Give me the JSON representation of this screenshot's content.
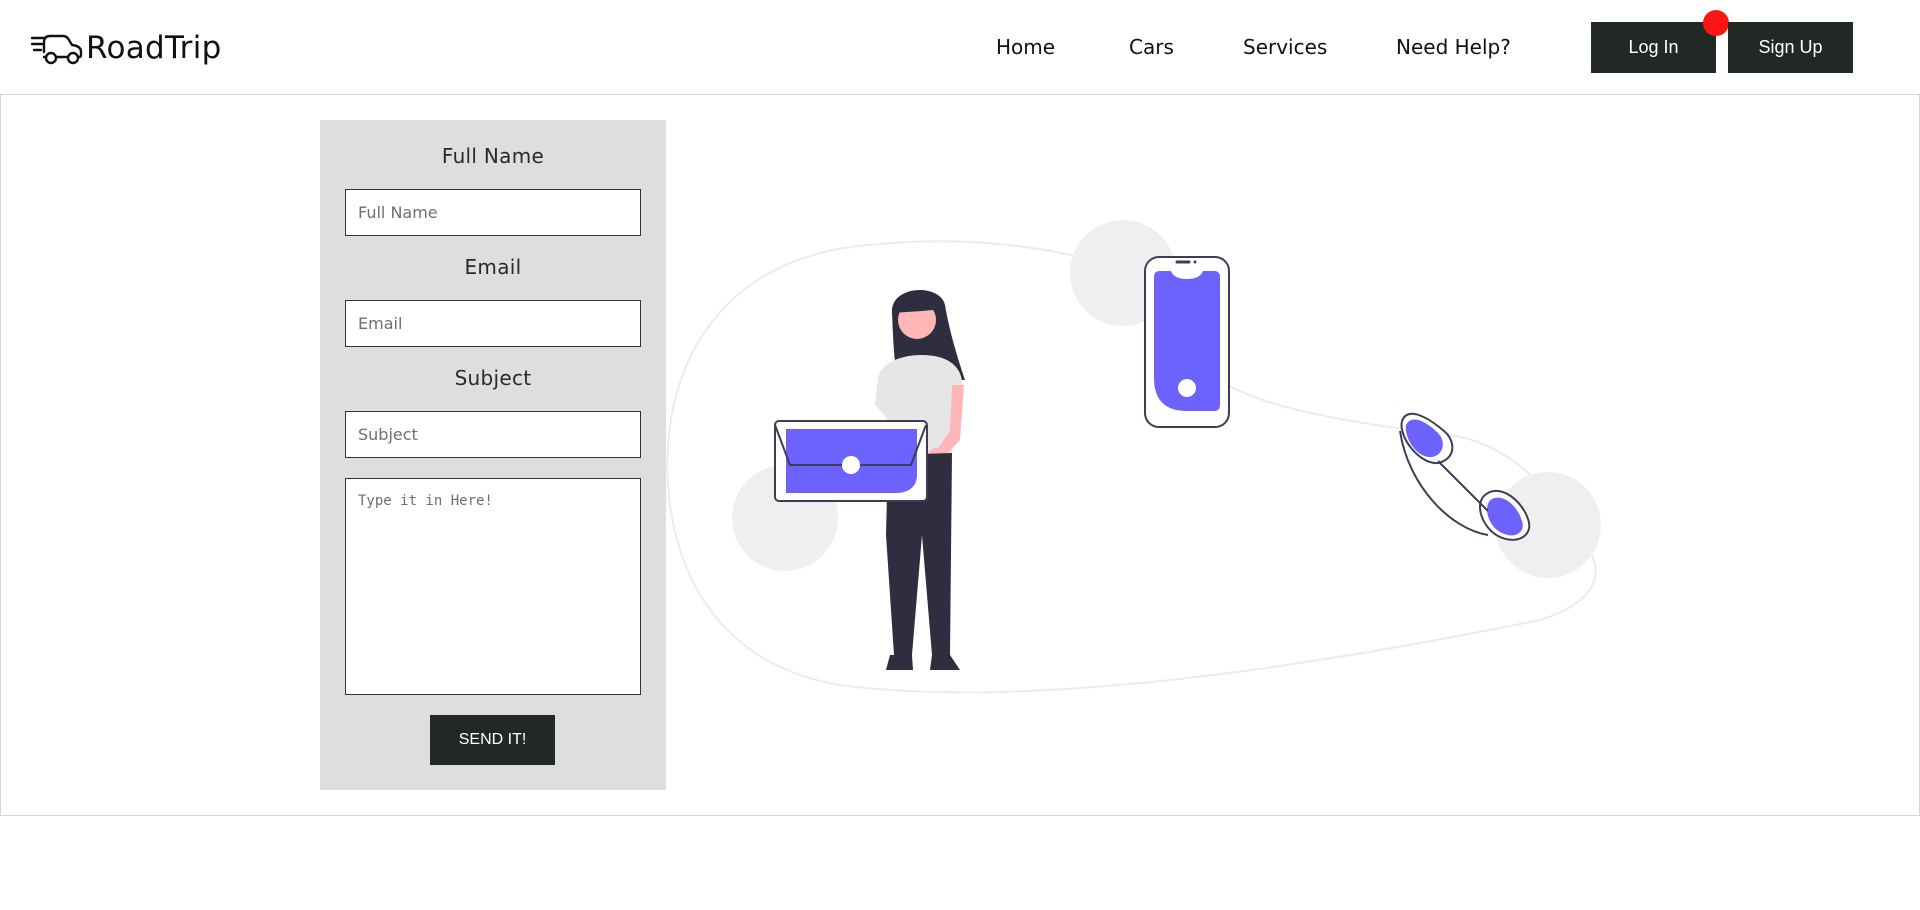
{
  "brand": {
    "name": "RoadTrip",
    "logo_icon": "car-speed-icon"
  },
  "nav": {
    "items": [
      {
        "label": "Home"
      },
      {
        "label": "Cars"
      },
      {
        "label": "Services"
      },
      {
        "label": "Need Help?"
      }
    ],
    "login_label": "Log In",
    "signup_label": "Sign Up"
  },
  "form": {
    "full_name_label": "Full Name",
    "full_name_placeholder": "Full Name",
    "email_label": "Email",
    "email_placeholder": "Email",
    "subject_label": "Subject",
    "subject_placeholder": "Subject",
    "message_placeholder": "Type it in Here!",
    "submit_label": "SEND IT!"
  },
  "colors": {
    "accent": "#6c63ff",
    "button_dark": "#222823",
    "notification": "#ff1414",
    "form_bg": "#dedede"
  }
}
